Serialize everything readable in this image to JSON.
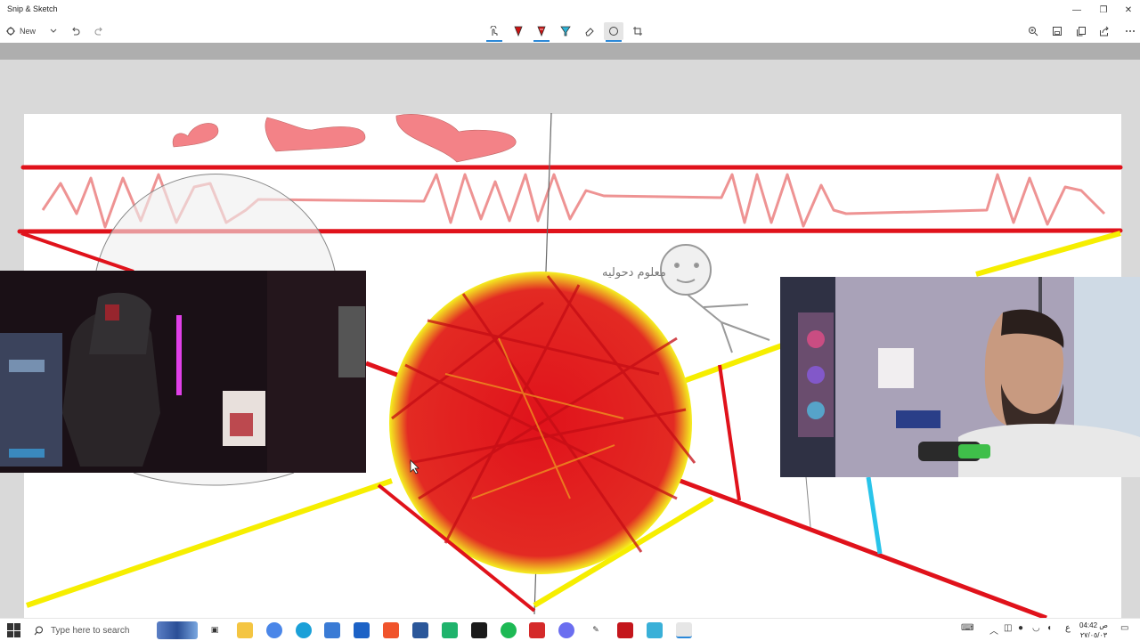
{
  "window": {
    "title": "Snip & Sketch",
    "minimize_glyph": "—",
    "restore_glyph": "❐",
    "close_glyph": "✕"
  },
  "toolbar": {
    "new_label": "New",
    "left_icons": [
      "new-snip-icon",
      "chevron-down-icon",
      "undo-icon",
      "redo-icon"
    ],
    "center_tools": [
      "touch-writing-icon",
      "ballpoint-pen-icon",
      "pencil-icon",
      "highlighter-icon",
      "eraser-icon",
      "protractor-icon",
      "crop-icon"
    ],
    "right_icons": [
      "zoom-icon",
      "save-icon",
      "copy-icon",
      "share-icon",
      "more-icon"
    ],
    "active_tool": "protractor-icon",
    "accent_color": "#2b88d8"
  },
  "canvas": {
    "band_color": "#aeaeae",
    "background_color": "#d9d9d9",
    "paper_color": "#ffffff",
    "ink_colors": {
      "red": "#e0121b",
      "yellow": "#f6ee00",
      "gray": "#555555",
      "cyan": "#29c4ea",
      "orange": "#f0a020"
    },
    "annotations": {
      "arabic_note": "معلوم دحوليه"
    }
  },
  "webcams": {
    "left": "room-camera",
    "right": "streamer-camera"
  },
  "taskbar": {
    "search_placeholder": "Type here to search",
    "apps": [
      "task-view-icon",
      "file-explorer-icon",
      "chrome-icon",
      "edge-icon",
      "store-icon",
      "mail-icon",
      "brave-icon",
      "word-icon",
      "app-green-icon",
      "app-razer-icon",
      "spotify-icon",
      "app-red-icon",
      "discord-icon",
      "pen-app-icon",
      "app-screen-icon",
      "notepad-icon",
      "snip-sketch-icon"
    ],
    "tray_icons": [
      "keyboard-icon",
      "chevron-up-icon",
      "network-icon",
      "mic-icon",
      "wifi-icon",
      "volume-icon",
      "language-icon"
    ],
    "language": "ع",
    "clock_time": "04:42 ص",
    "clock_date": "٢٧/٠٥/٠٣",
    "notification_icon": "notification-icon"
  }
}
